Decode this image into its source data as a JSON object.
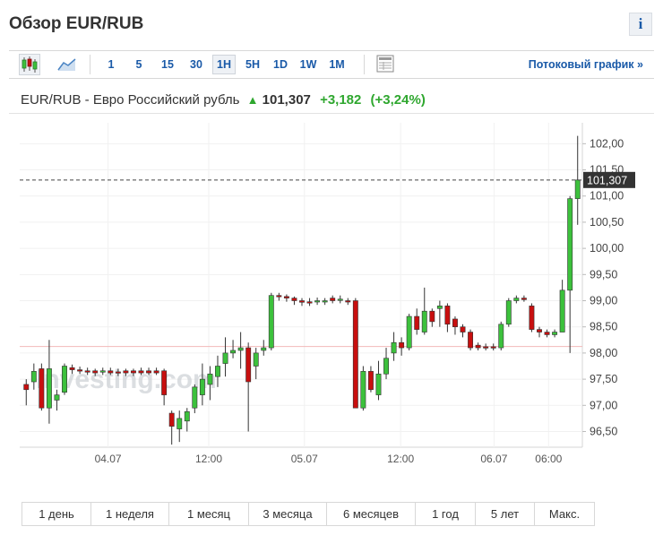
{
  "header": {
    "title": "Обзор EUR/RUB",
    "info_label": "i"
  },
  "toolbar": {
    "icons": [
      "candlestick-chart-icon",
      "area-chart-icon",
      "table-icon"
    ],
    "timeframes": [
      "1",
      "5",
      "15",
      "30",
      "1H",
      "5H",
      "1D",
      "1W",
      "1M"
    ],
    "active_timeframe": "1H",
    "stream_link": "Потоковый график »"
  },
  "quote": {
    "pair": "EUR/RUB - Евро Российский рубль",
    "price": "101,307",
    "change": "+3,182",
    "change_pct": "(+3,24%)"
  },
  "watermark": "Investing.com",
  "ranges": [
    "1 день",
    "1 неделя",
    "1 месяц",
    "3 месяца",
    "6 месяцев",
    "1 год",
    "5 лет",
    "Макс."
  ],
  "colors": {
    "up": "#3cc13c",
    "down": "#c80f0f",
    "link": "#1a5aa8",
    "price_tag": "#333333",
    "ref_line": "#f2b8b8"
  },
  "chart_data": {
    "type": "candlestick",
    "ylim": [
      96.2,
      102.4
    ],
    "y_ticks": [
      "102,00",
      "101,50",
      "101,00",
      "100,50",
      "100,00",
      "99,50",
      "99,00",
      "98,50",
      "98,00",
      "97,50",
      "97,00",
      "96,50"
    ],
    "x_labels": [
      "04.07",
      "12:00",
      "05.07",
      "12:00",
      "06.07",
      "06:00"
    ],
    "last_price": 101.307,
    "last_price_label": "101,307",
    "reference_price": 98.125,
    "candles": [
      [
        97.4,
        97.3,
        97.5,
        97.0
      ],
      [
        97.45,
        97.65,
        97.8,
        97.3
      ],
      [
        97.7,
        96.95,
        97.8,
        96.9
      ],
      [
        96.95,
        97.7,
        98.25,
        96.65
      ],
      [
        97.1,
        97.2,
        97.3,
        96.9
      ],
      [
        97.25,
        97.75,
        97.8,
        97.2
      ],
      [
        97.72,
        97.68,
        97.78,
        97.6
      ],
      [
        97.68,
        97.66,
        97.74,
        97.6
      ],
      [
        97.66,
        97.64,
        97.72,
        97.58
      ],
      [
        97.66,
        97.62,
        97.7,
        97.56
      ],
      [
        97.64,
        97.66,
        97.72,
        97.58
      ],
      [
        97.66,
        97.62,
        97.72,
        97.58
      ],
      [
        97.64,
        97.62,
        97.7,
        97.56
      ],
      [
        97.66,
        97.62,
        97.7,
        97.56
      ],
      [
        97.66,
        97.62,
        97.7,
        97.56
      ],
      [
        97.66,
        97.62,
        97.72,
        97.58
      ],
      [
        97.66,
        97.62,
        97.72,
        97.58
      ],
      [
        97.66,
        97.62,
        97.72,
        97.58
      ],
      [
        97.66,
        97.2,
        97.7,
        97.0
      ],
      [
        96.85,
        96.6,
        96.9,
        96.25
      ],
      [
        96.55,
        96.75,
        96.9,
        96.3
      ],
      [
        96.7,
        96.88,
        96.95,
        96.5
      ],
      [
        96.95,
        97.35,
        97.4,
        96.85
      ],
      [
        97.2,
        97.5,
        97.8,
        97.0
      ],
      [
        97.4,
        97.6,
        97.75,
        97.1
      ],
      [
        97.55,
        97.75,
        97.95,
        97.35
      ],
      [
        97.8,
        98.0,
        98.3,
        97.55
      ],
      [
        98.0,
        98.05,
        98.25,
        97.9
      ],
      [
        98.05,
        98.1,
        98.4,
        97.7
      ],
      [
        98.1,
        97.45,
        98.2,
        96.5
      ],
      [
        97.75,
        98.0,
        98.1,
        97.5
      ],
      [
        98.05,
        98.1,
        98.25,
        97.95
      ],
      [
        98.1,
        99.1,
        99.15,
        98.05
      ],
      [
        99.1,
        99.08,
        99.15,
        99.0
      ],
      [
        99.08,
        99.05,
        99.12,
        98.98
      ],
      [
        99.05,
        99.0,
        99.08,
        98.92
      ],
      [
        99.0,
        98.97,
        99.05,
        98.9
      ],
      [
        98.98,
        98.97,
        99.05,
        98.9
      ],
      [
        98.98,
        99.0,
        99.06,
        98.92
      ],
      [
        98.98,
        99.0,
        99.05,
        98.92
      ],
      [
        99.05,
        99.0,
        99.1,
        98.95
      ],
      [
        99.02,
        99.03,
        99.1,
        98.95
      ],
      [
        99.0,
        98.98,
        99.05,
        98.92
      ],
      [
        99.0,
        96.95,
        99.05,
        96.95
      ],
      [
        96.95,
        97.65,
        97.75,
        96.9
      ],
      [
        97.65,
        97.3,
        97.75,
        97.25
      ],
      [
        97.2,
        97.6,
        97.85,
        97.1
      ],
      [
        97.6,
        97.9,
        98.1,
        97.5
      ],
      [
        98.0,
        98.2,
        98.4,
        97.85
      ],
      [
        98.2,
        98.1,
        98.3,
        97.95
      ],
      [
        98.1,
        98.7,
        98.75,
        98.05
      ],
      [
        98.7,
        98.45,
        98.85,
        98.35
      ],
      [
        98.4,
        98.8,
        99.25,
        98.35
      ],
      [
        98.8,
        98.6,
        98.85,
        98.5
      ],
      [
        98.85,
        98.9,
        99.0,
        98.5
      ],
      [
        98.9,
        98.55,
        98.95,
        98.4
      ],
      [
        98.65,
        98.5,
        98.7,
        98.35
      ],
      [
        98.5,
        98.4,
        98.55,
        98.3
      ],
      [
        98.4,
        98.1,
        98.45,
        98.05
      ],
      [
        98.15,
        98.1,
        98.2,
        98.05
      ],
      [
        98.12,
        98.1,
        98.18,
        98.05
      ],
      [
        98.12,
        98.1,
        98.18,
        98.05
      ],
      [
        98.1,
        98.55,
        98.6,
        98.05
      ],
      [
        98.55,
        99.0,
        99.05,
        98.5
      ],
      [
        99.0,
        99.05,
        99.1,
        98.95
      ],
      [
        99.05,
        99.02,
        99.1,
        98.98
      ],
      [
        98.9,
        98.45,
        98.95,
        98.4
      ],
      [
        98.45,
        98.4,
        98.5,
        98.3
      ],
      [
        98.4,
        98.35,
        98.45,
        98.3
      ],
      [
        98.35,
        98.4,
        98.45,
        98.3
      ],
      [
        98.4,
        99.2,
        99.4,
        98.4
      ],
      [
        99.2,
        100.95,
        101.0,
        98.0
      ],
      [
        100.95,
        101.307,
        102.15,
        100.45
      ]
    ]
  }
}
